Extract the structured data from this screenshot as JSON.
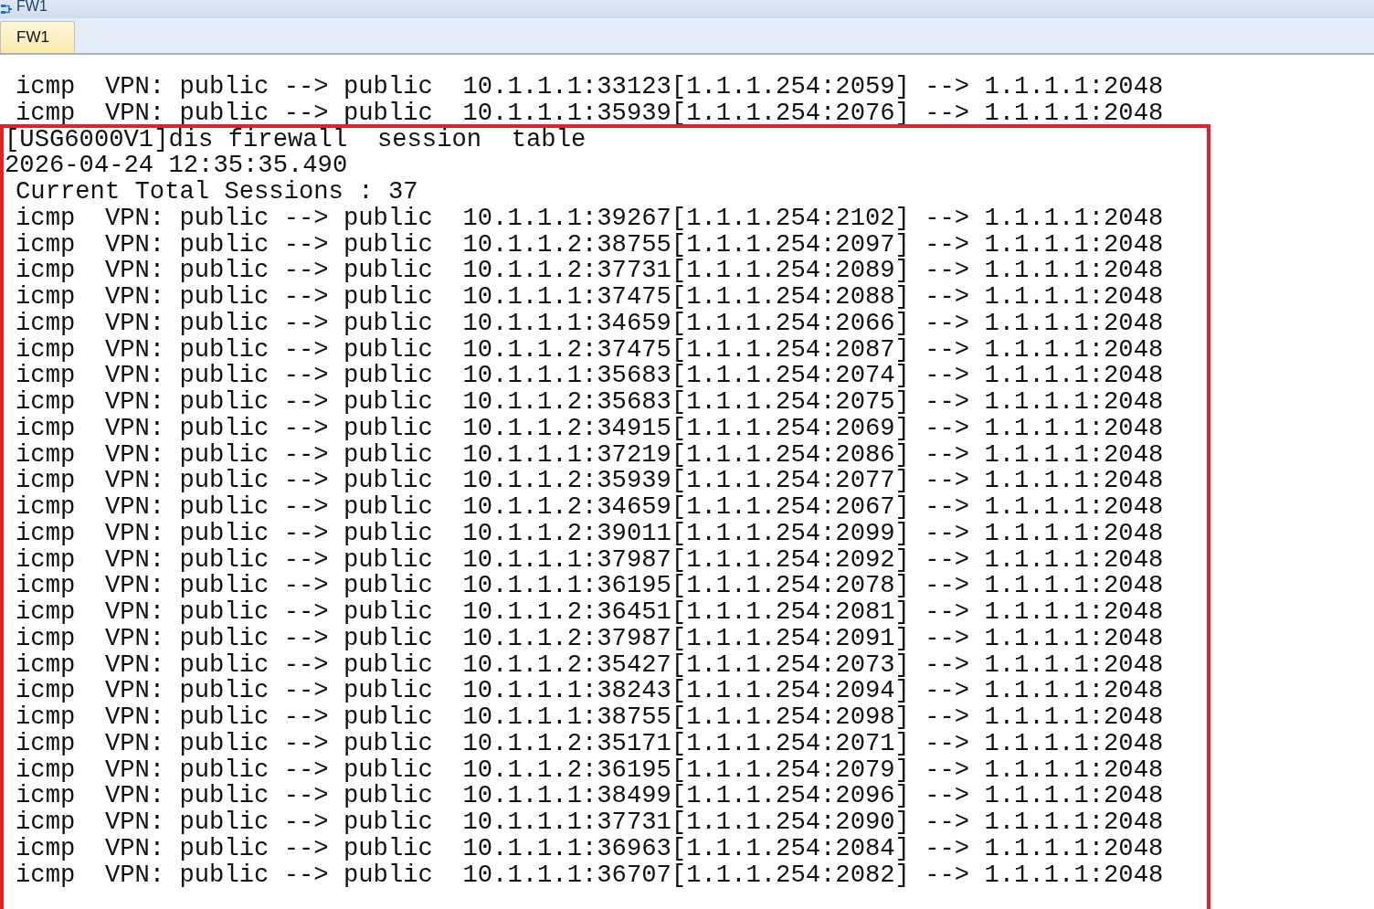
{
  "window": {
    "title": "FW1"
  },
  "tabs": [
    {
      "label": "FW1",
      "selected": true
    }
  ],
  "terminal": {
    "lines": [
      {
        "kind": "session",
        "text": "icmp  VPN: public --> public  10.1.1.1:33123[1.1.1.254:2059] --> 1.1.1.1:2048"
      },
      {
        "kind": "session",
        "text": "icmp  VPN: public --> public  10.1.1.1:35939[1.1.1.254:2076] --> 1.1.1.1:2048"
      },
      {
        "kind": "command",
        "text": "[USG6000V1]dis firewall  session  table"
      },
      {
        "kind": "timestamp",
        "text": "2026-04-24 12:35:35.490"
      },
      {
        "kind": "info",
        "text": "Current Total Sessions : 37"
      },
      {
        "kind": "session",
        "text": "icmp  VPN: public --> public  10.1.1.1:39267[1.1.1.254:2102] --> 1.1.1.1:2048"
      },
      {
        "kind": "session",
        "text": "icmp  VPN: public --> public  10.1.1.2:38755[1.1.1.254:2097] --> 1.1.1.1:2048"
      },
      {
        "kind": "session",
        "text": "icmp  VPN: public --> public  10.1.1.2:37731[1.1.1.254:2089] --> 1.1.1.1:2048"
      },
      {
        "kind": "session",
        "text": "icmp  VPN: public --> public  10.1.1.1:37475[1.1.1.254:2088] --> 1.1.1.1:2048"
      },
      {
        "kind": "session",
        "text": "icmp  VPN: public --> public  10.1.1.1:34659[1.1.1.254:2066] --> 1.1.1.1:2048"
      },
      {
        "kind": "session",
        "text": "icmp  VPN: public --> public  10.1.1.2:37475[1.1.1.254:2087] --> 1.1.1.1:2048"
      },
      {
        "kind": "session",
        "text": "icmp  VPN: public --> public  10.1.1.1:35683[1.1.1.254:2074] --> 1.1.1.1:2048"
      },
      {
        "kind": "session",
        "text": "icmp  VPN: public --> public  10.1.1.2:35683[1.1.1.254:2075] --> 1.1.1.1:2048"
      },
      {
        "kind": "session",
        "text": "icmp  VPN: public --> public  10.1.1.2:34915[1.1.1.254:2069] --> 1.1.1.1:2048"
      },
      {
        "kind": "session",
        "text": "icmp  VPN: public --> public  10.1.1.1:37219[1.1.1.254:2086] --> 1.1.1.1:2048"
      },
      {
        "kind": "session",
        "text": "icmp  VPN: public --> public  10.1.1.2:35939[1.1.1.254:2077] --> 1.1.1.1:2048"
      },
      {
        "kind": "session",
        "text": "icmp  VPN: public --> public  10.1.1.2:34659[1.1.1.254:2067] --> 1.1.1.1:2048"
      },
      {
        "kind": "session",
        "text": "icmp  VPN: public --> public  10.1.1.2:39011[1.1.1.254:2099] --> 1.1.1.1:2048"
      },
      {
        "kind": "session",
        "text": "icmp  VPN: public --> public  10.1.1.1:37987[1.1.1.254:2092] --> 1.1.1.1:2048"
      },
      {
        "kind": "session",
        "text": "icmp  VPN: public --> public  10.1.1.1:36195[1.1.1.254:2078] --> 1.1.1.1:2048"
      },
      {
        "kind": "session",
        "text": "icmp  VPN: public --> public  10.1.1.2:36451[1.1.1.254:2081] --> 1.1.1.1:2048"
      },
      {
        "kind": "session",
        "text": "icmp  VPN: public --> public  10.1.1.2:37987[1.1.1.254:2091] --> 1.1.1.1:2048"
      },
      {
        "kind": "session",
        "text": "icmp  VPN: public --> public  10.1.1.2:35427[1.1.1.254:2073] --> 1.1.1.1:2048"
      },
      {
        "kind": "session",
        "text": "icmp  VPN: public --> public  10.1.1.1:38243[1.1.1.254:2094] --> 1.1.1.1:2048"
      },
      {
        "kind": "session",
        "text": "icmp  VPN: public --> public  10.1.1.1:38755[1.1.1.254:2098] --> 1.1.1.1:2048"
      },
      {
        "kind": "session",
        "text": "icmp  VPN: public --> public  10.1.1.2:35171[1.1.1.254:2071] --> 1.1.1.1:2048"
      },
      {
        "kind": "session",
        "text": "icmp  VPN: public --> public  10.1.1.2:36195[1.1.1.254:2079] --> 1.1.1.1:2048"
      },
      {
        "kind": "session",
        "text": "icmp  VPN: public --> public  10.1.1.1:38499[1.1.1.254:2096] --> 1.1.1.1:2048"
      },
      {
        "kind": "session",
        "text": "icmp  VPN: public --> public  10.1.1.1:37731[1.1.1.254:2090] --> 1.1.1.1:2048"
      },
      {
        "kind": "session",
        "text": "icmp  VPN: public --> public  10.1.1.1:36963[1.1.1.254:2084] --> 1.1.1.1:2048"
      },
      {
        "kind": "session",
        "text": "icmp  VPN: public --> public  10.1.1.1:36707[1.1.1.254:2082] --> 1.1.1.1:2048"
      }
    ]
  }
}
